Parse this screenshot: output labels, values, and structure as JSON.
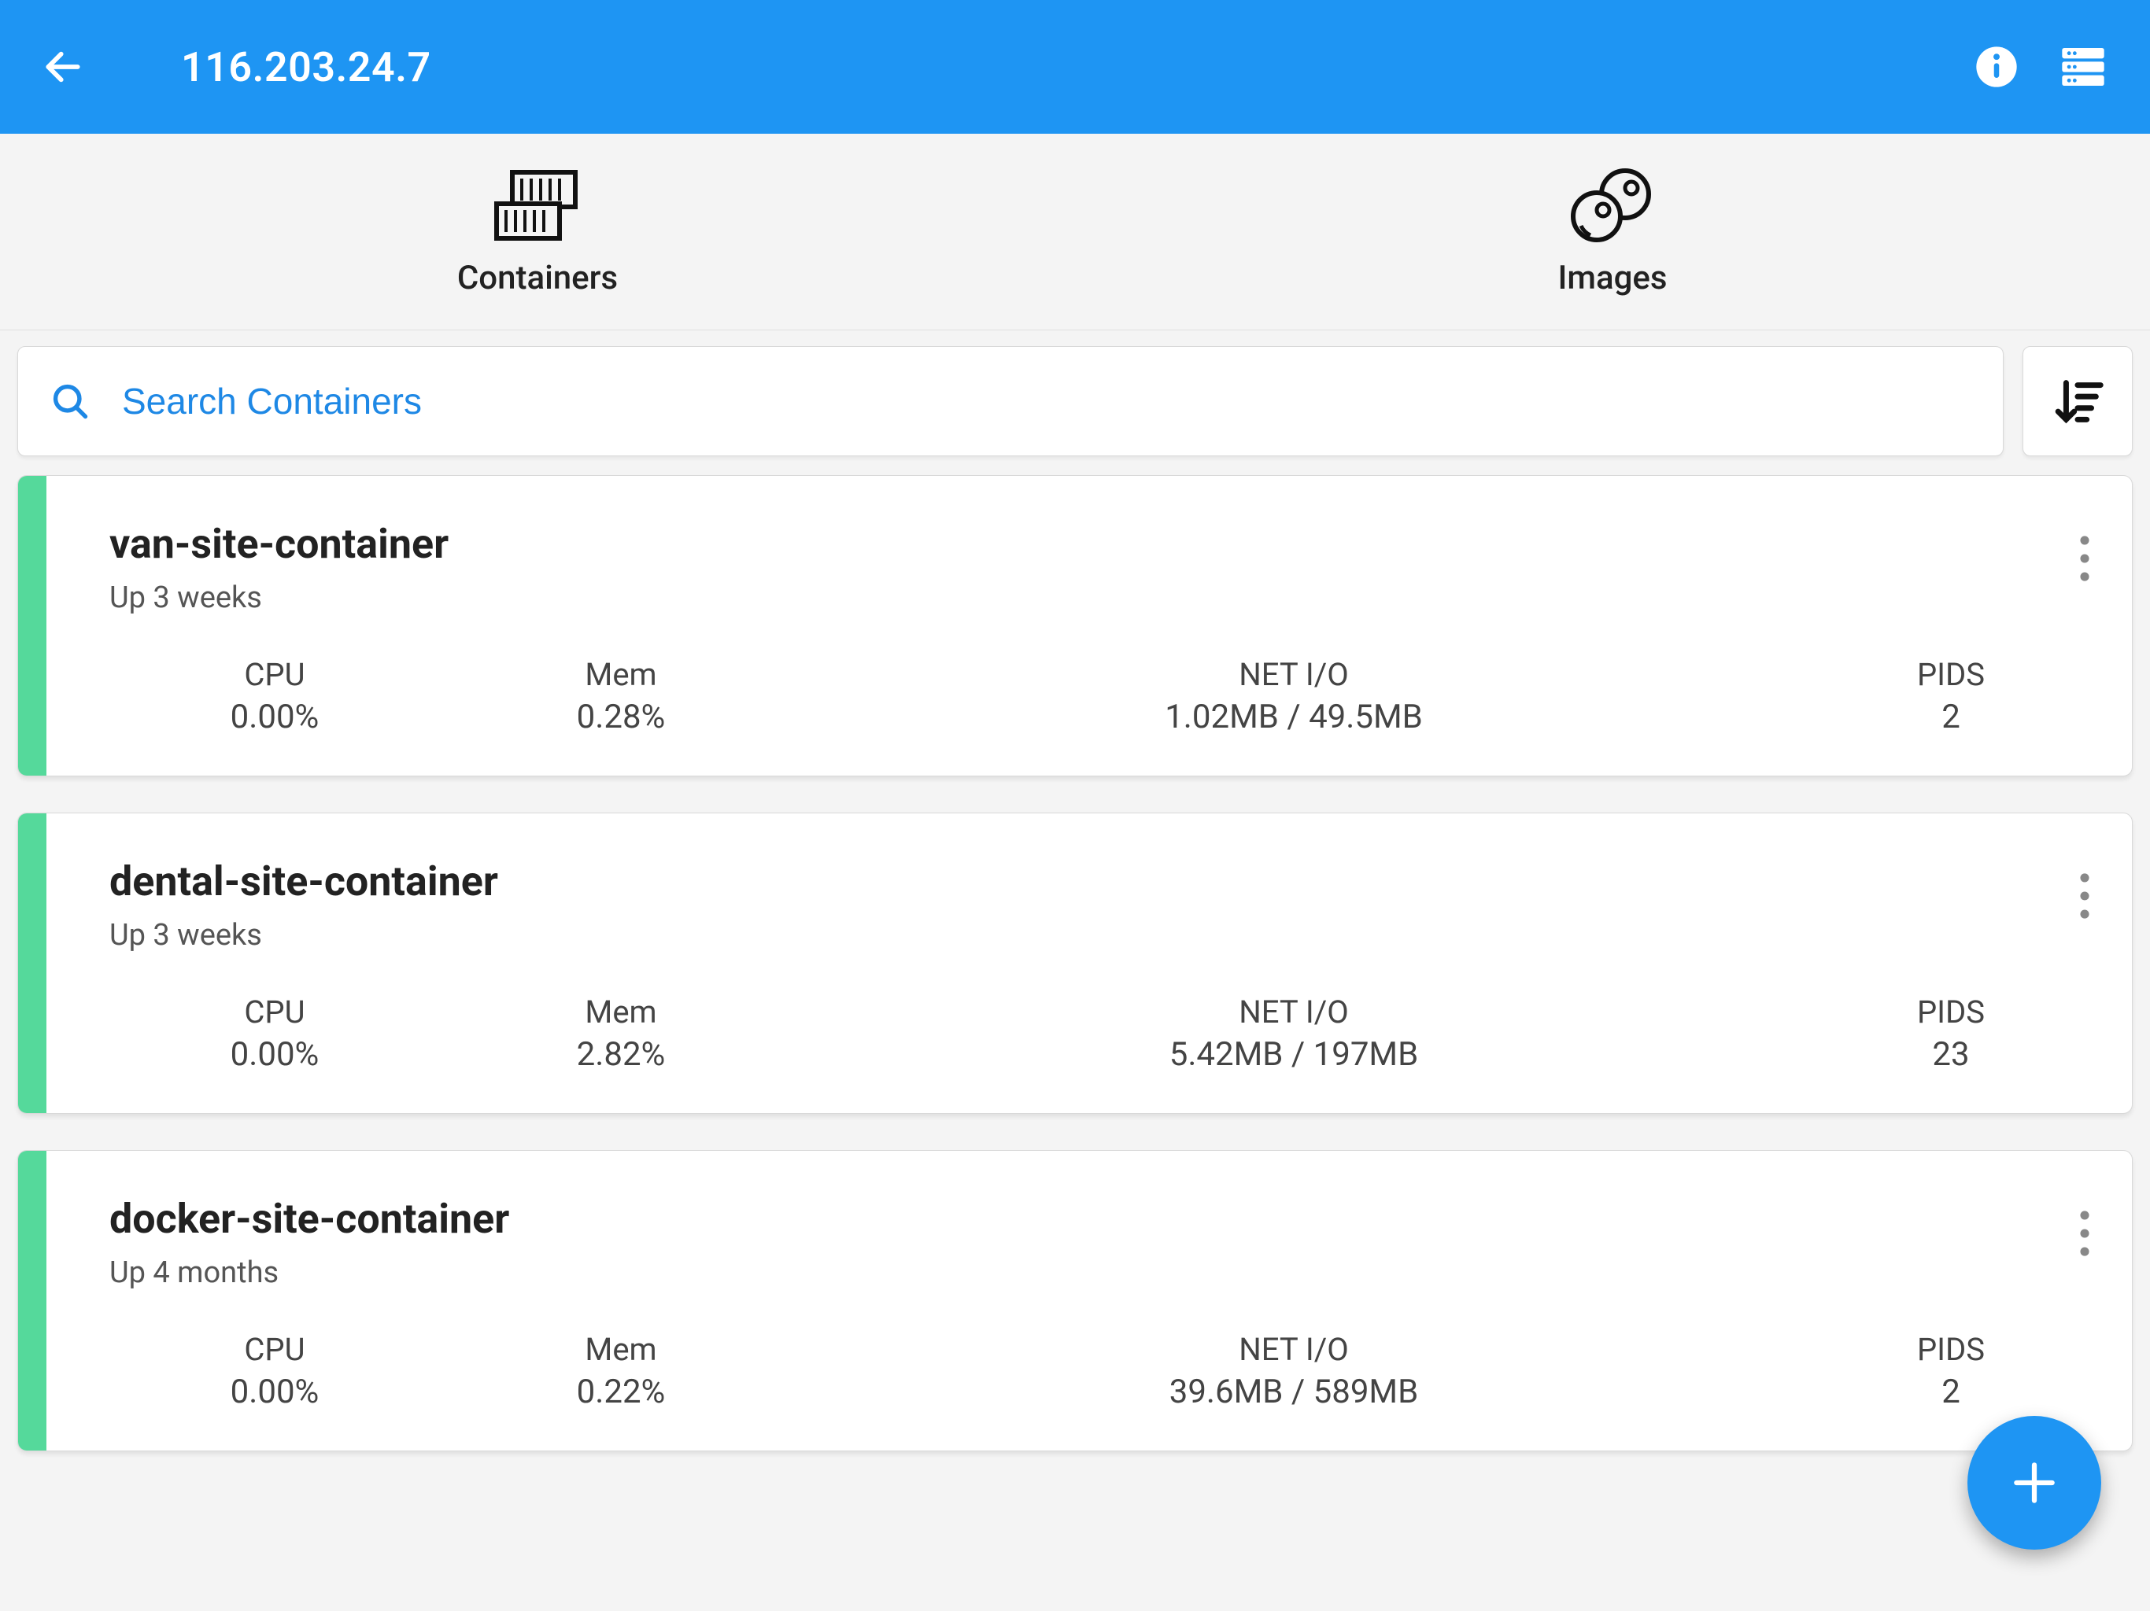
{
  "header": {
    "title": "116.203.24.7"
  },
  "tabs": {
    "containers_label": "Containers",
    "images_label": "Images"
  },
  "search": {
    "placeholder": "Search Containers"
  },
  "stat_labels": {
    "cpu": "CPU",
    "mem": "Mem",
    "net": "NET I/O",
    "pids": "PIDS"
  },
  "containers": [
    {
      "name": "van-site-container",
      "status": "Up 3 weeks",
      "cpu": "0.00%",
      "mem": "0.28%",
      "net": "1.02MB / 49.5MB",
      "pids": "2"
    },
    {
      "name": "dental-site-container",
      "status": "Up 3 weeks",
      "cpu": "0.00%",
      "mem": "2.82%",
      "net": "5.42MB / 197MB",
      "pids": "23"
    },
    {
      "name": "docker-site-container",
      "status": "Up 4 months",
      "cpu": "0.00%",
      "mem": "0.22%",
      "net": "39.6MB / 589MB",
      "pids": "2"
    }
  ]
}
